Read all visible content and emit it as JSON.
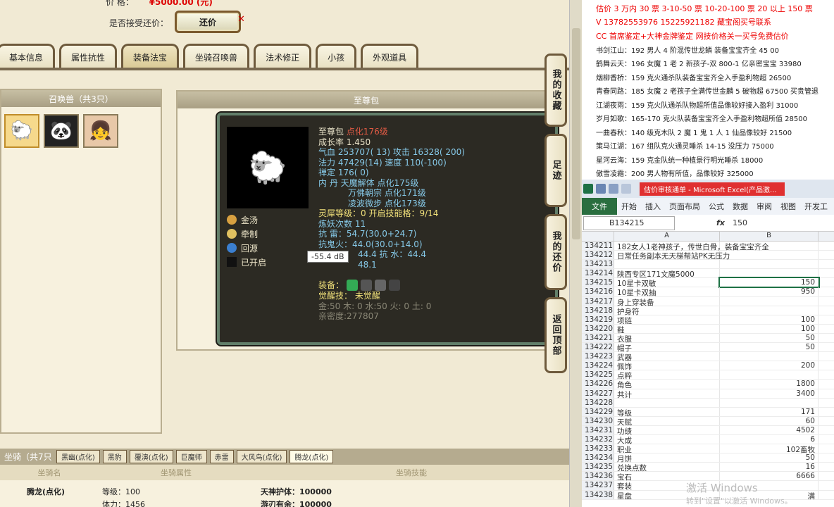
{
  "game": {
    "price_label": "价        格：",
    "price_value": "¥5000.00 (元)",
    "counter_label": "是否接受还价：",
    "counter_button": "还价",
    "tabs": [
      "基本信息",
      "属性抗性",
      "装备法宝",
      "坐骑召唤兽",
      "法术修正",
      "小孩",
      "外观道具"
    ],
    "pet_header": "召唤兽（共3只）",
    "detail_header": "至尊包",
    "stats": {
      "name": "至尊包",
      "name_tag": "点化176级",
      "growth": "成长率 1.450",
      "hp": "气血 253707( 13) 攻击 16328( 200)",
      "mp": "法力 47429(14) 速度 110(-100)",
      "zen": "禅定 176( 0)",
      "dan1": "内    丹 天魔解体 点化175级",
      "dan2": "万佛朝宗 点化171级",
      "dan3": "凌波微步 点化173级",
      "lingxi": "灵犀等级：0 开启技能格：9/14",
      "lianyao": "炼妖次数 11",
      "kang_lei": "抗    雷：54.7(30.0+24.7)",
      "kang_huo": "抗鬼火：44.0(30.0+14.0)",
      "kang_shui": "44.4 抗    水：44.4",
      "kang_last": "48.1",
      "equip": "装备：",
      "awaken": "觉醒技：  未觉醒",
      "elements": "金:50 木: 0 水:50 火: 0 土: 0",
      "intimacy": "亲密度:277807"
    },
    "skills": [
      "金汤",
      "牵制",
      "回源",
      "已开启"
    ],
    "tooltip": "-55.4 dB",
    "side_tabs": [
      "我的收藏",
      "足迹",
      "我的还价",
      "返回顶部"
    ],
    "mount_label": "坐骑（共7只",
    "mount_tabs": [
      "黑幽(点化)",
      "黑豹",
      "覆演(点化)",
      "巨魔师",
      "赤雷",
      "大风鸟(点化)",
      "腾龙(点化)"
    ],
    "mount_cols": [
      "坐骑名",
      "坐骑属性",
      "坐骑技能"
    ],
    "mount_name": "腾龙(点化)",
    "mount_attr1": "等级：100",
    "mount_attr2": "体力：1456",
    "mount_skill1": "天神护体：100000",
    "mount_skill2": "游刃有余：100000"
  },
  "notes": {
    "lines": [
      "估价 3 万内 30 票    3-10-50 票    10-20-100 票    20 以上 150 票",
      "V 13782553976    15225921182   藏宝阁买号联系",
      "CC 首席鉴定+大神金牌鉴定   网技价格关一买号免费估价",
      "书剑江山：192 男人 4 阶混传世龙鳞 装备宝宝齐全 45 00",
      "鹤舞云天：196 女魔 1 老 2 新孩子-双 800-1 亿亲密宝宝 33980",
      "烟柳香桥：159 克火通杀队装备宝宝齐全入手盈利物超 26500",
      "青春同路：185 女魔 2 老孩子全满传世金麟 5 破物超 67500 买贵管退",
      "江湖夜雨：159 克火队通杀队物超所值品像较好接入盈利 31000",
      "岁月如歌：165-170 克火队装备宝宝齐全入手盈利物超所值 28500",
      "一曲春秋：140 级克木队 2 魔 1 鬼 1 人 1 仙品像较好 21500",
      "策马江湖：167 组队克火通灵睡杀 14-15 没压力 75000",
      "星河云海：159 克金队统一种植景行明光睡杀 18000",
      "傲雪凌霜：200 男人物有所值，品像较好 325000"
    ]
  },
  "excel": {
    "title": "估价审核通单 - Microsoft Excel(产品激...",
    "ribbon": [
      "文件",
      "开始",
      "插入",
      "页面布局",
      "公式",
      "数据",
      "审阅",
      "视图",
      "开发工"
    ],
    "name_box": "B134215",
    "fx": "fx",
    "formula": "150",
    "col_a": "A",
    "col_b": "B",
    "rows": [
      {
        "n": "134211",
        "a": "182女人1老神孩子，传世白骨，装备宝宝齐全",
        "b": ""
      },
      {
        "n": "134212",
        "a": "日常任务副本无天梯帮站PK无压力",
        "b": ""
      },
      {
        "n": "134213",
        "a": "",
        "b": ""
      },
      {
        "n": "134214",
        "a": "陕西专区171文魔5000",
        "b": ""
      },
      {
        "n": "134215",
        "a": "10星卡双敏",
        "b": "150"
      },
      {
        "n": "134216",
        "a": "10星卡双抽",
        "b": "950"
      },
      {
        "n": "134217",
        "a": "身上穿装备",
        "b": ""
      },
      {
        "n": "134218",
        "a": "护身符",
        "b": ""
      },
      {
        "n": "134219",
        "a": "项链",
        "b": "100"
      },
      {
        "n": "134220",
        "a": "鞋",
        "b": "100"
      },
      {
        "n": "134221",
        "a": "衣服",
        "b": "50"
      },
      {
        "n": "134222",
        "a": "帽子",
        "b": "50"
      },
      {
        "n": "134223",
        "a": "武器",
        "b": ""
      },
      {
        "n": "134224",
        "a": "佩饰",
        "b": "200"
      },
      {
        "n": "134225",
        "a": "点粹",
        "b": ""
      },
      {
        "n": "134226",
        "a": "角色",
        "b": "1800"
      },
      {
        "n": "134227",
        "a": "共计",
        "b": "3400"
      },
      {
        "n": "134228",
        "a": "",
        "b": ""
      },
      {
        "n": "134229",
        "a": "等级",
        "b": "171"
      },
      {
        "n": "134230",
        "a": "天赋",
        "b": "60"
      },
      {
        "n": "134231",
        "a": "功绩",
        "b": "4502"
      },
      {
        "n": "134232",
        "a": "大成",
        "b": "6"
      },
      {
        "n": "134233",
        "a": "职业",
        "b": "102畜牧"
      },
      {
        "n": "134234",
        "a": "月饼",
        "b": "50"
      },
      {
        "n": "134235",
        "a": "兑换点数",
        "b": "16"
      },
      {
        "n": "134236",
        "a": "宝石",
        "b": "6666"
      },
      {
        "n": "134237",
        "a": "套装",
        "b": ""
      },
      {
        "n": "134238",
        "a": "星盘",
        "b": "满"
      }
    ],
    "watermark1": "激活 Windows",
    "watermark2": "转到\"设置\"以激活 Windows。"
  }
}
